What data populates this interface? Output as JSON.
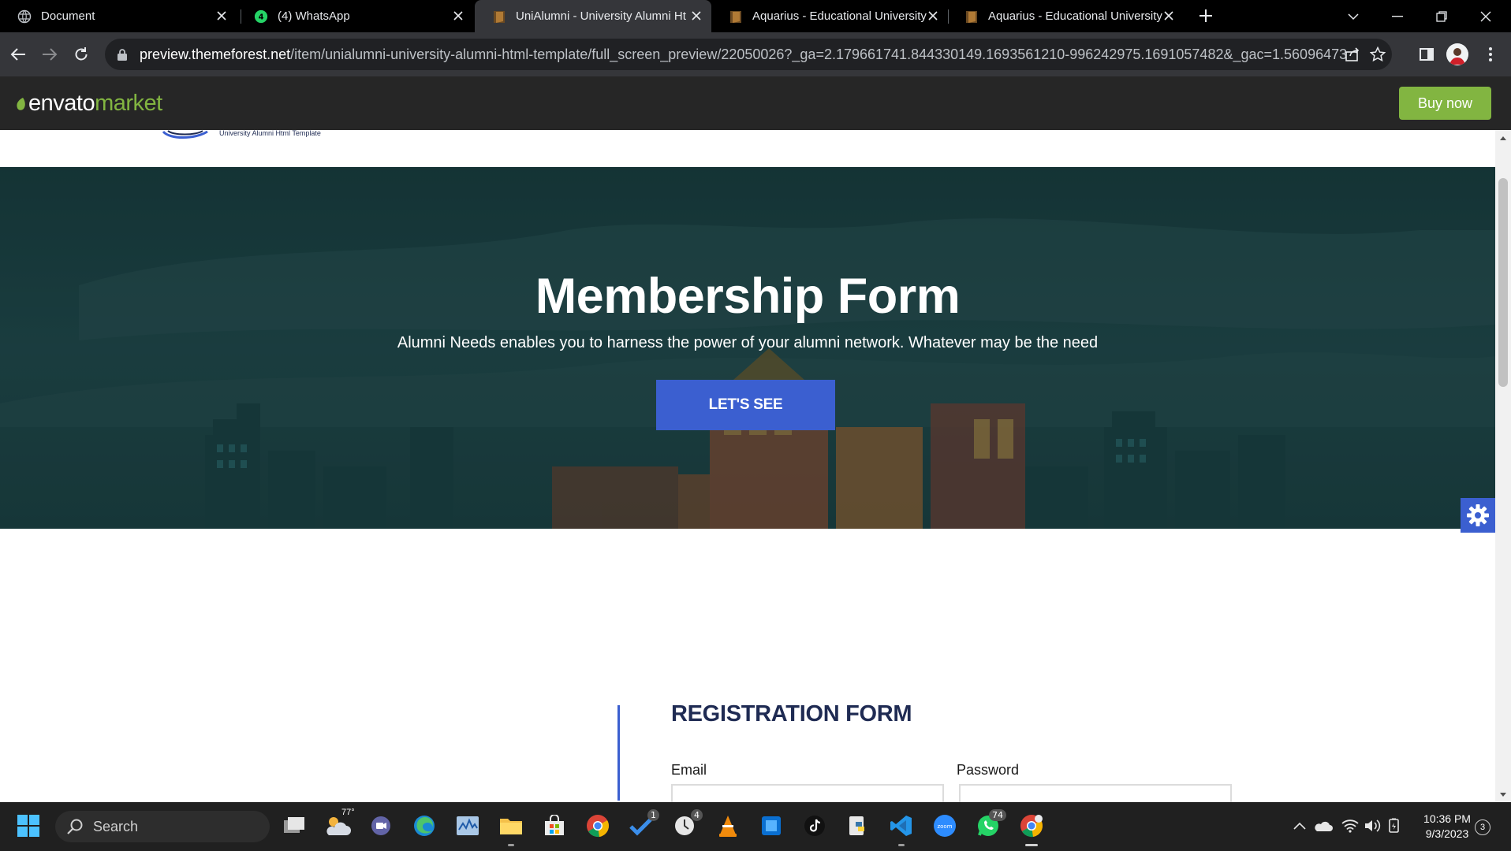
{
  "browser": {
    "tabs": [
      {
        "title": "Document",
        "favicon": "globe-icon",
        "active": false
      },
      {
        "title": "(4) WhatsApp",
        "favicon": "whatsapp-icon",
        "badge": "4",
        "active": false
      },
      {
        "title": "UniAlumni - University Alumni Ht",
        "favicon": "themeforest-icon",
        "active": true
      },
      {
        "title": "Aquarius - Educational University",
        "favicon": "themeforest-icon",
        "active": false
      },
      {
        "title": "Aquarius - Educational University",
        "favicon": "themeforest-icon",
        "active": false
      }
    ],
    "url_host": "preview.themeforest.net",
    "url_path": "/item/unialumni-university-alumni-html-template/full_screen_preview/22050026?_ga=2.179661741.844330149.1693561210-996242975.1691057482&_gac=1.56096473.169..."
  },
  "envato": {
    "logo_word1": "envato",
    "logo_word2": "market",
    "buy_now": "Buy now",
    "accent": "#82b541"
  },
  "site": {
    "logo_tagline": "University Alumni Html Template"
  },
  "hero": {
    "title": "Membership Form",
    "subtitle": "Alumni Needs enables you to harness the power of your alumni network. Whatever may be the need",
    "button": "LET'S SEE",
    "accent": "#3b5fd0"
  },
  "registration": {
    "title": "REGISTRATION FORM",
    "email_label": "Email",
    "password_label": "Password"
  },
  "taskbar": {
    "search_placeholder": "Search",
    "weather_temp": "77°",
    "badges": {
      "todo": "1",
      "clock": "4",
      "whatsapp": "74"
    },
    "time": "10:36 PM",
    "date": "9/3/2023",
    "notifications": "3"
  }
}
